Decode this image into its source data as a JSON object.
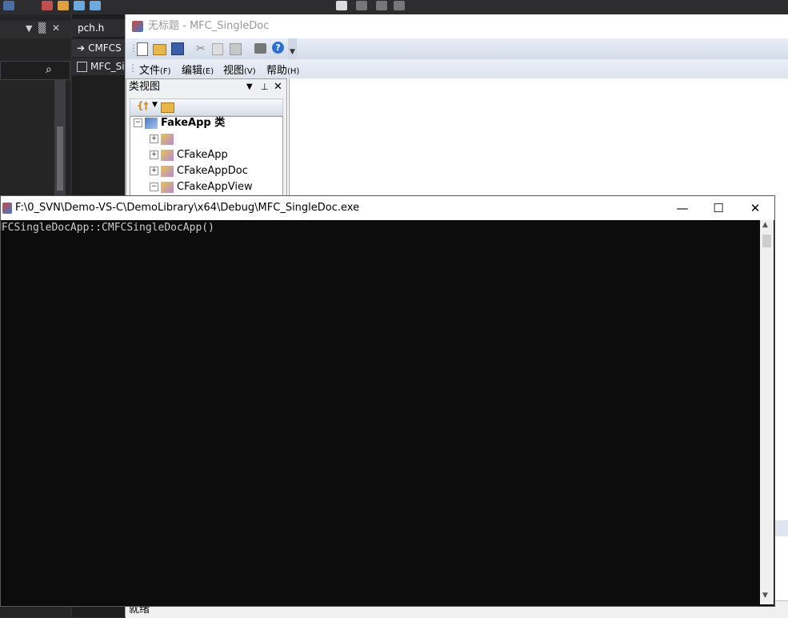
{
  "vs": {
    "left_pane_title": "",
    "pin_label": "▒",
    "close_label": "✕",
    "tab_pch": "pch.h",
    "nav_row1": "CMFCS",
    "nav_row2": "MFC_Si",
    "search_icon": "⌕"
  },
  "mfc": {
    "title": "无标题 - MFC_SingleDoc",
    "menu": [
      {
        "label": "文件",
        "accel": "(F)"
      },
      {
        "label": "编辑",
        "accel": "(E)"
      },
      {
        "label": "视图",
        "accel": "(V)"
      },
      {
        "label": "帮助",
        "accel": "(H)"
      }
    ],
    "toolbar_icons": [
      "new-file-icon",
      "open-folder-icon",
      "save-icon",
      "cut-icon",
      "copy-icon",
      "paste-icon",
      "print-icon",
      "help-icon"
    ],
    "classview": {
      "title": "类视图",
      "root": "FakeApp 类",
      "items": [
        "",
        "CFakeApp",
        "CFakeAppDoc",
        "CFakeAppView"
      ]
    },
    "status": "就绪"
  },
  "console": {
    "title": "F:\\0_SVN\\Demo-VS-C\\DemoLibrary\\x64\\Debug\\MFC_SingleDoc.exe",
    "output": "MFCSingleDocApp::CMFCSingleDocApp()",
    "minimize": "—",
    "maximize": "☐",
    "close": "✕"
  }
}
